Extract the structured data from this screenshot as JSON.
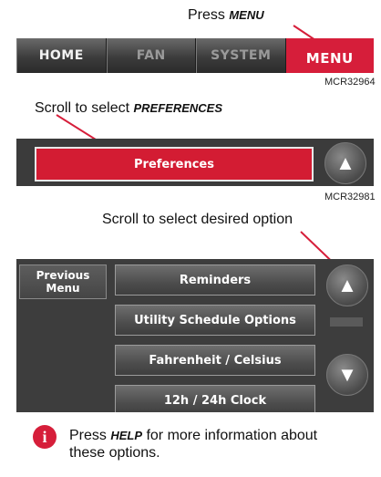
{
  "step1": {
    "instruction_prefix": "Press ",
    "instruction_key": "MENU",
    "tabs": [
      "HOME",
      "FAN",
      "SYSTEM",
      "MENU"
    ],
    "ref": "MCR32964"
  },
  "step2": {
    "instruction_prefix": "Scroll to select ",
    "instruction_key": "PREFERENCES",
    "button_label": "Preferences",
    "up_arrow": "▲",
    "ref": "MCR32981"
  },
  "step3": {
    "instruction": "Scroll to select desired option",
    "previous_menu_line1": "Previous",
    "previous_menu_line2": "Menu",
    "options": [
      "Reminders",
      "Utility Schedule Options",
      "Fahrenheit / Celsius",
      "12h / 24h Clock"
    ],
    "up_arrow": "▲",
    "down_arrow": "▼"
  },
  "note": {
    "icon": "info-icon",
    "prefix": "Press ",
    "key": "HELP",
    "suffix": " for more information about these options."
  },
  "colors": {
    "accent_red": "#d61e3a",
    "panel_dark": "#3d3d3d"
  }
}
